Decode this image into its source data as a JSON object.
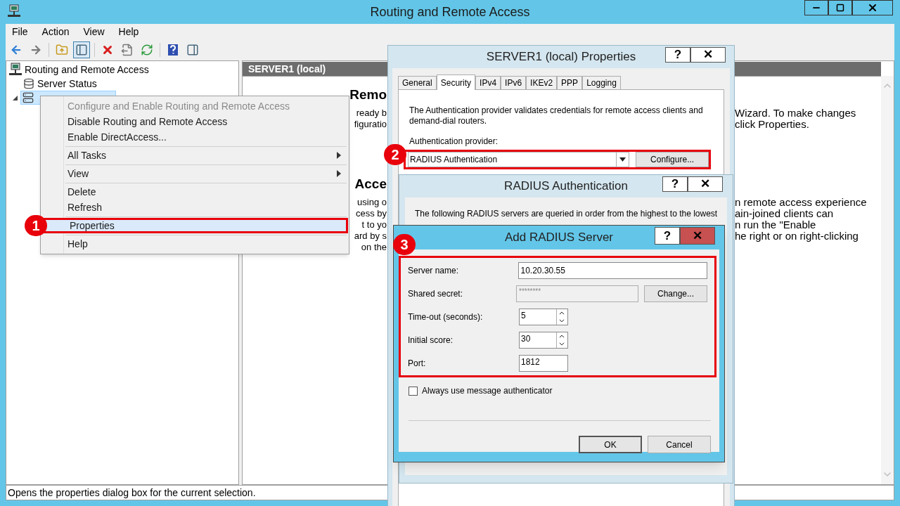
{
  "window": {
    "title": "Routing and Remote Access"
  },
  "menu_bar": [
    "File",
    "Action",
    "View",
    "Help"
  ],
  "toolbar": [
    {
      "kind": "back",
      "pressed": false
    },
    {
      "kind": "forward",
      "pressed": false
    },
    {
      "kind": "separator"
    },
    {
      "kind": "up",
      "pressed": false
    },
    {
      "kind": "console-tree",
      "pressed": true
    },
    {
      "kind": "separator"
    },
    {
      "kind": "delete",
      "pressed": false
    },
    {
      "kind": "export",
      "pressed": false
    },
    {
      "kind": "refresh",
      "pressed": false
    },
    {
      "kind": "separator"
    },
    {
      "kind": "help",
      "pressed": false
    },
    {
      "kind": "action-pane",
      "pressed": false
    }
  ],
  "tree": {
    "root": "Routing and Remote Access",
    "items": [
      {
        "label": "Server Status"
      }
    ],
    "server_node": {
      "selected": true,
      "expanded": true
    }
  },
  "details": {
    "header": "SERVER1 (local)",
    "sections": [
      {
        "heading": "Remo",
        "left": [
          "ready b",
          "figuratio"
        ],
        "right": [
          "Wizard. To make changes",
          "click Properties."
        ]
      },
      {
        "heading": "Acce",
        "left": [
          "using o",
          "cess by",
          "t to yo",
          "ard by s",
          "on the"
        ],
        "right": [
          "n remote access experience",
          "ain-joined clients can",
          "n run the \"Enable",
          "he right or on right-clicking"
        ]
      }
    ]
  },
  "status_bar": "Opens the properties dialog box for the current selection.",
  "context_menu": [
    {
      "kind": "item",
      "label": "Configure and Enable Routing and Remote Access",
      "disabled": true,
      "submenu": false,
      "selected": false
    },
    {
      "kind": "item",
      "label": "Disable Routing and Remote Access",
      "disabled": false,
      "submenu": false,
      "selected": false
    },
    {
      "kind": "item",
      "label": "Enable DirectAccess...",
      "disabled": false,
      "submenu": false,
      "selected": false
    },
    {
      "kind": "separator"
    },
    {
      "kind": "item",
      "label": "All Tasks",
      "disabled": false,
      "submenu": true,
      "selected": false
    },
    {
      "kind": "separator"
    },
    {
      "kind": "item",
      "label": "View",
      "disabled": false,
      "submenu": true,
      "selected": false
    },
    {
      "kind": "separator"
    },
    {
      "kind": "item",
      "label": "Delete",
      "disabled": false,
      "submenu": false,
      "selected": false
    },
    {
      "kind": "item",
      "label": "Refresh",
      "disabled": false,
      "submenu": false,
      "selected": false
    },
    {
      "kind": "separator"
    },
    {
      "kind": "item",
      "label": "Properties",
      "disabled": false,
      "submenu": false,
      "selected": true,
      "callout": "1"
    },
    {
      "kind": "separator"
    },
    {
      "kind": "item",
      "label": "Help",
      "disabled": false,
      "submenu": false,
      "selected": false
    }
  ],
  "properties_dialog": {
    "title": "SERVER1 (local) Properties",
    "title_buttons": [
      "?",
      "✕"
    ],
    "tabs": [
      {
        "label": "General",
        "selected": false
      },
      {
        "label": "Security",
        "selected": true
      },
      {
        "label": "IPv4",
        "selected": false
      },
      {
        "label": "IPv6",
        "selected": false
      },
      {
        "label": "IKEv2",
        "selected": false
      },
      {
        "label": "PPP",
        "selected": false
      },
      {
        "label": "Logging",
        "selected": false
      }
    ],
    "description": "The Authentication provider validates credentials for remote access clients and demand-dial routers.",
    "provider_label": "Authentication provider:",
    "provider": "RADIUS Authentication",
    "configure_button": "Configure...",
    "callout": "2"
  },
  "radius_dialog": {
    "title": "RADIUS Authentication",
    "title_buttons": [
      "?",
      "✕"
    ],
    "description": "The following RADIUS servers are queried in order from the highest to the lowest"
  },
  "add_server_dialog": {
    "title": "Add RADIUS Server",
    "title_buttons": [
      "?",
      "✕"
    ],
    "callout": "3",
    "fields": [
      {
        "kind": "text",
        "label": "Server name:",
        "value": "10.20.30.55"
      },
      {
        "kind": "secret",
        "label": "Shared secret:",
        "value": "********",
        "button": "Change..."
      },
      {
        "kind": "spin",
        "label": "Time-out (seconds):",
        "value": "5"
      },
      {
        "kind": "spin",
        "label": "Initial score:",
        "value": "30"
      },
      {
        "kind": "short",
        "label": "Port:",
        "value": "1812"
      }
    ],
    "checkbox": {
      "label": "Always use message authenticator",
      "checked": false
    },
    "buttons": [
      {
        "label": "OK",
        "default": true
      },
      {
        "label": "Cancel",
        "default": false
      }
    ]
  }
}
